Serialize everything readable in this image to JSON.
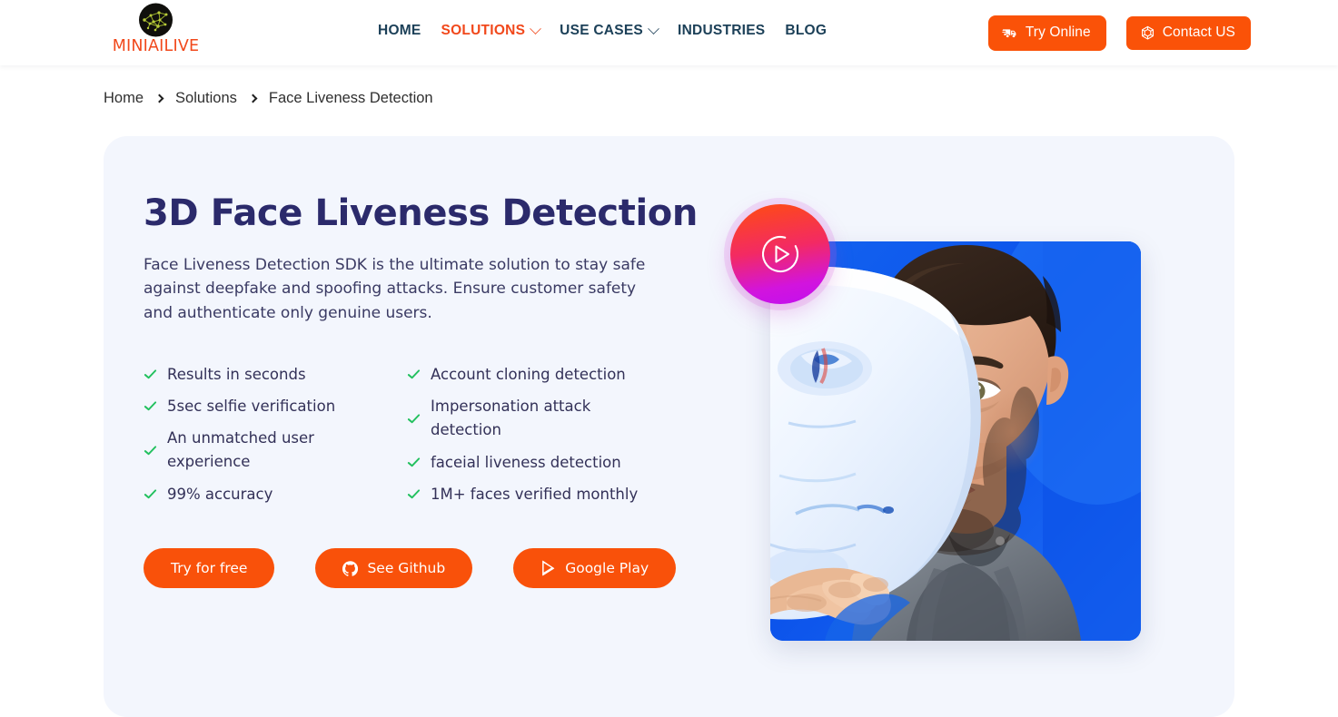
{
  "header": {
    "logo": {
      "mark_icon": "neural-network-logo-icon",
      "wordmark": "MINIAILIVE"
    },
    "nav": [
      {
        "label": "HOME",
        "icon": null,
        "active": false
      },
      {
        "label": "SOLUTIONS",
        "icon": "chevron-down-icon",
        "active": true
      },
      {
        "label": "USE CASES",
        "icon": "chevron-down-icon",
        "active": false
      },
      {
        "label": "INDUSTRIES",
        "icon": null,
        "active": false
      },
      {
        "label": "BLOG",
        "icon": null,
        "active": false
      }
    ],
    "actions": [
      {
        "label": "Try Online",
        "icon": "truck-fast-icon"
      },
      {
        "label": "Contact US",
        "icon": "hexagon-outline-icon"
      }
    ]
  },
  "breadcrumb": {
    "items": [
      {
        "label": "Home"
      },
      {
        "label": "Solutions"
      },
      {
        "label": "Face Liveness Detection"
      }
    ],
    "separator_icon": "chevron-right-icon"
  },
  "hero": {
    "title": "3D Face Liveness Detection",
    "description": "Face Liveness Detection SDK is the ultimate solution to stay safe against deepfake and spoofing attacks. Ensure customer safety and authenticate only genuine users.",
    "features_left": [
      "Results in seconds",
      "5sec selfie verification",
      "An unmatched user experience",
      "99% accuracy"
    ],
    "features_right": [
      "Account cloning detection",
      "Impersonation attack detection",
      "faceial liveness detection",
      "1M+ faces verified monthly"
    ],
    "feature_check_icon": "check-icon",
    "ctas": [
      {
        "label": "Try for free",
        "icon": null
      },
      {
        "label": "See Github",
        "icon": "github-icon"
      },
      {
        "label": "Google Play",
        "icon": "google-play-icon"
      }
    ],
    "media": {
      "play_button_icon": "play-circle-icon",
      "image_alt": "Man holding a white face mask over half of his face against a blue background"
    }
  },
  "colors": {
    "brand_orange": "#fa5208",
    "cta_orange": "#f9510a",
    "nav_navy": "#1c4058",
    "heading_indigo": "#2b2a6b",
    "body_text": "#3a3a63",
    "check_green": "#22c05e",
    "hero_card_bg": "#f3f6fd",
    "page_bg": "#ffffff"
  }
}
